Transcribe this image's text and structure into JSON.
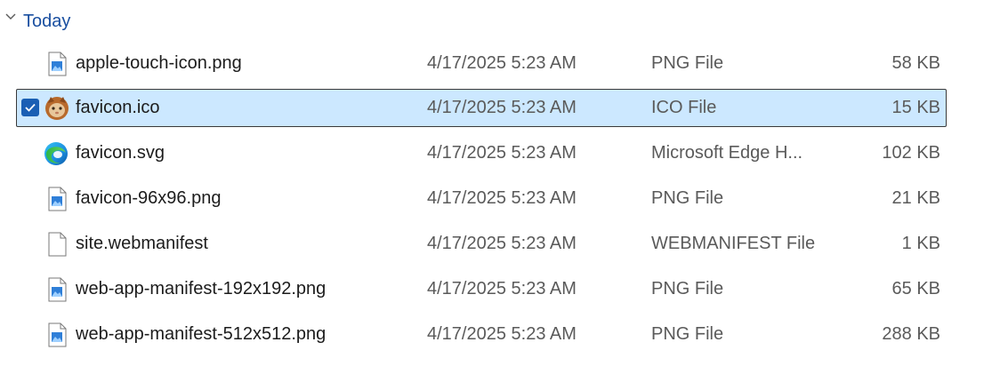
{
  "group": {
    "title": "Today"
  },
  "files": [
    {
      "name": "apple-touch-icon.png",
      "date": "4/17/2025 5:23 AM",
      "type": "PNG File",
      "size": "58 KB",
      "icon": "png-image-icon",
      "selected": false
    },
    {
      "name": "favicon.ico",
      "date": "4/17/2025 5:23 AM",
      "type": "ICO File",
      "size": "15 KB",
      "icon": "cat-thumbnail-icon",
      "selected": true
    },
    {
      "name": "favicon.svg",
      "date": "4/17/2025 5:23 AM",
      "type": "Microsoft Edge H...",
      "size": "102 KB",
      "icon": "edge-browser-icon",
      "selected": false
    },
    {
      "name": "favicon-96x96.png",
      "date": "4/17/2025 5:23 AM",
      "type": "PNG File",
      "size": "21 KB",
      "icon": "png-image-icon",
      "selected": false
    },
    {
      "name": "site.webmanifest",
      "date": "4/17/2025 5:23 AM",
      "type": "WEBMANIFEST File",
      "size": "1 KB",
      "icon": "blank-file-icon",
      "selected": false
    },
    {
      "name": "web-app-manifest-192x192.png",
      "date": "4/17/2025 5:23 AM",
      "type": "PNG File",
      "size": "65 KB",
      "icon": "png-image-icon",
      "selected": false
    },
    {
      "name": "web-app-manifest-512x512.png",
      "date": "4/17/2025 5:23 AM",
      "type": "PNG File",
      "size": "288 KB",
      "icon": "png-image-icon",
      "selected": false
    }
  ],
  "colors": {
    "accent": "#1a4fa0",
    "selection_bg": "#cce8ff",
    "checkbox": "#1a5fb4"
  }
}
